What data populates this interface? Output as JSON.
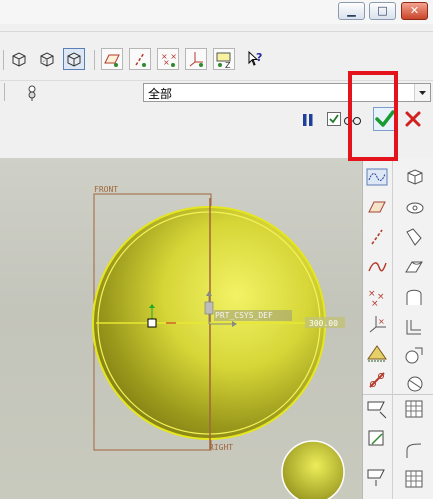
{
  "window": {
    "minimize_glyph": "▁",
    "maximize_glyph": "□",
    "close_glyph": "✕"
  },
  "filter": {
    "selected": "全部"
  },
  "graphics": {
    "datum_front": "FRONT",
    "datum_right": "RIGHT",
    "csys_label": "PRT_CSYS_DEF",
    "dimension_value": "300.00"
  },
  "colors": {
    "sphere": "#dede35",
    "datum": "#a0663c",
    "highlight_box": "#e4121b",
    "confirm": "#1a9a32",
    "cancel": "#d02020"
  }
}
